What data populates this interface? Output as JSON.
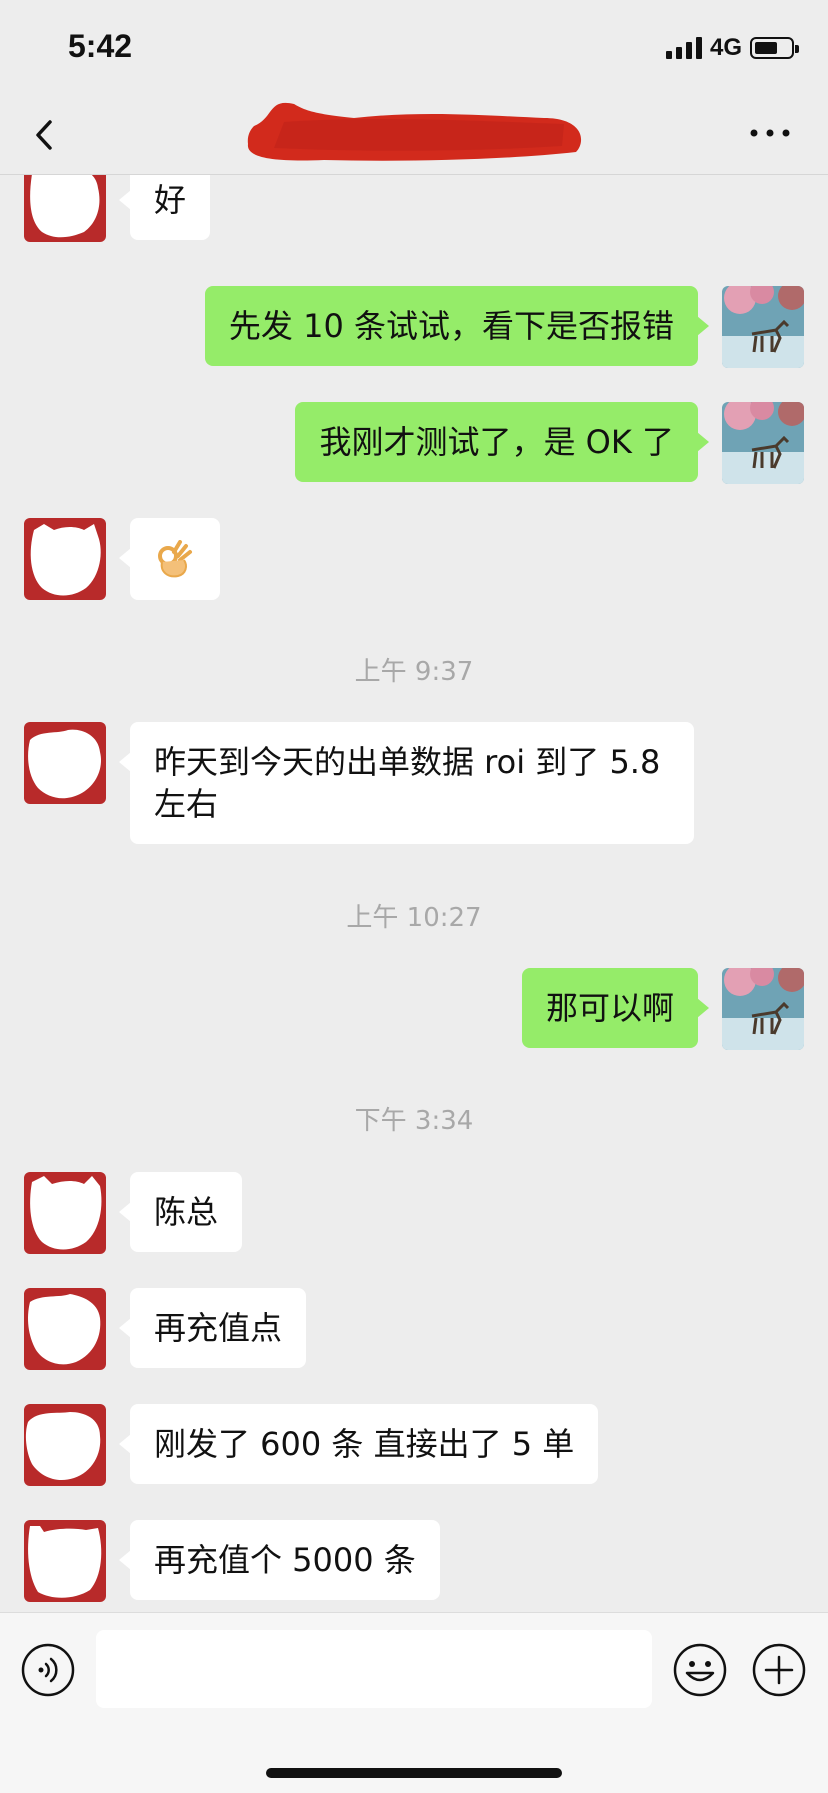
{
  "status_bar": {
    "time": "5:42",
    "network": "4G",
    "battery_level": 0.65
  },
  "nav": {
    "back_icon": "chevron-left-icon",
    "more_icon": "more-dots-icon",
    "title_redacted": true
  },
  "colors": {
    "background": "#ededed",
    "sent_bubble": "#95ec69",
    "received_bubble": "#ffffff",
    "avatar_red": "#b82a2a",
    "timestamp": "#a8a8a8"
  },
  "messages": {
    "m1": {
      "text": "好"
    },
    "m2": {
      "text": "先发 10 条试试，看下是否报错"
    },
    "m3": {
      "text": "我刚才测试了，是 OK 了"
    },
    "m4": {
      "emoji": "ok-hand-icon"
    },
    "t1": {
      "text": "上午 9:37"
    },
    "m5": {
      "text": "昨天到今天的出单数据 roi 到了 5.8 左右"
    },
    "t2": {
      "text": "上午 10:27"
    },
    "m6": {
      "text": "那可以啊"
    },
    "t3": {
      "text": "下午 3:34"
    },
    "m7": {
      "text": "陈总"
    },
    "m8": {
      "text": "再充值点"
    },
    "m9": {
      "text": "刚发了 600 条 直接出了 5 单"
    },
    "m10": {
      "text": "再充值个 5000 条"
    }
  },
  "input_bar": {
    "voice_icon": "voice-icon",
    "emoji_icon": "emoji-face-icon",
    "plus_icon": "plus-circle-icon",
    "input_value": "",
    "placeholder": ""
  }
}
